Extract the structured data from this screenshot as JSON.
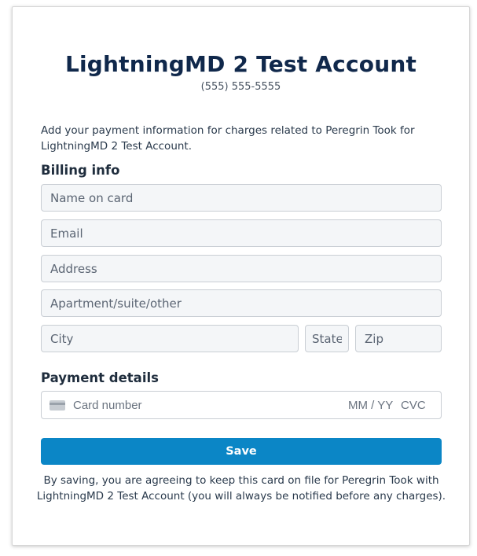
{
  "header": {
    "title": "LightningMD 2 Test Account",
    "phone": "(555) 555-5555"
  },
  "intro_text": "Add your payment information for charges related to Peregrin Took for LightningMD 2 Test Account.",
  "billing": {
    "heading": "Billing info",
    "name_placeholder": "Name on card",
    "email_placeholder": "Email",
    "address_placeholder": "Address",
    "apartment_placeholder": "Apartment/suite/other",
    "city_placeholder": "City",
    "state_placeholder": "State",
    "zip_placeholder": "Zip"
  },
  "payment": {
    "heading": "Payment details",
    "card_icon": "credit-card-icon",
    "card_number_placeholder": "Card number",
    "expiry_placeholder": "MM / YY",
    "cvc_placeholder": "CVC"
  },
  "actions": {
    "save_label": "Save"
  },
  "disclaimer": "By saving, you are agreeing to keep this card on file for Peregrin Took with LightningMD 2 Test Account (you will always be notified before any charges).",
  "colors": {
    "title": "#10284b",
    "primary_button": "#0b86c6",
    "field_background": "#f4f6f8",
    "field_border": "#c9ced4"
  }
}
